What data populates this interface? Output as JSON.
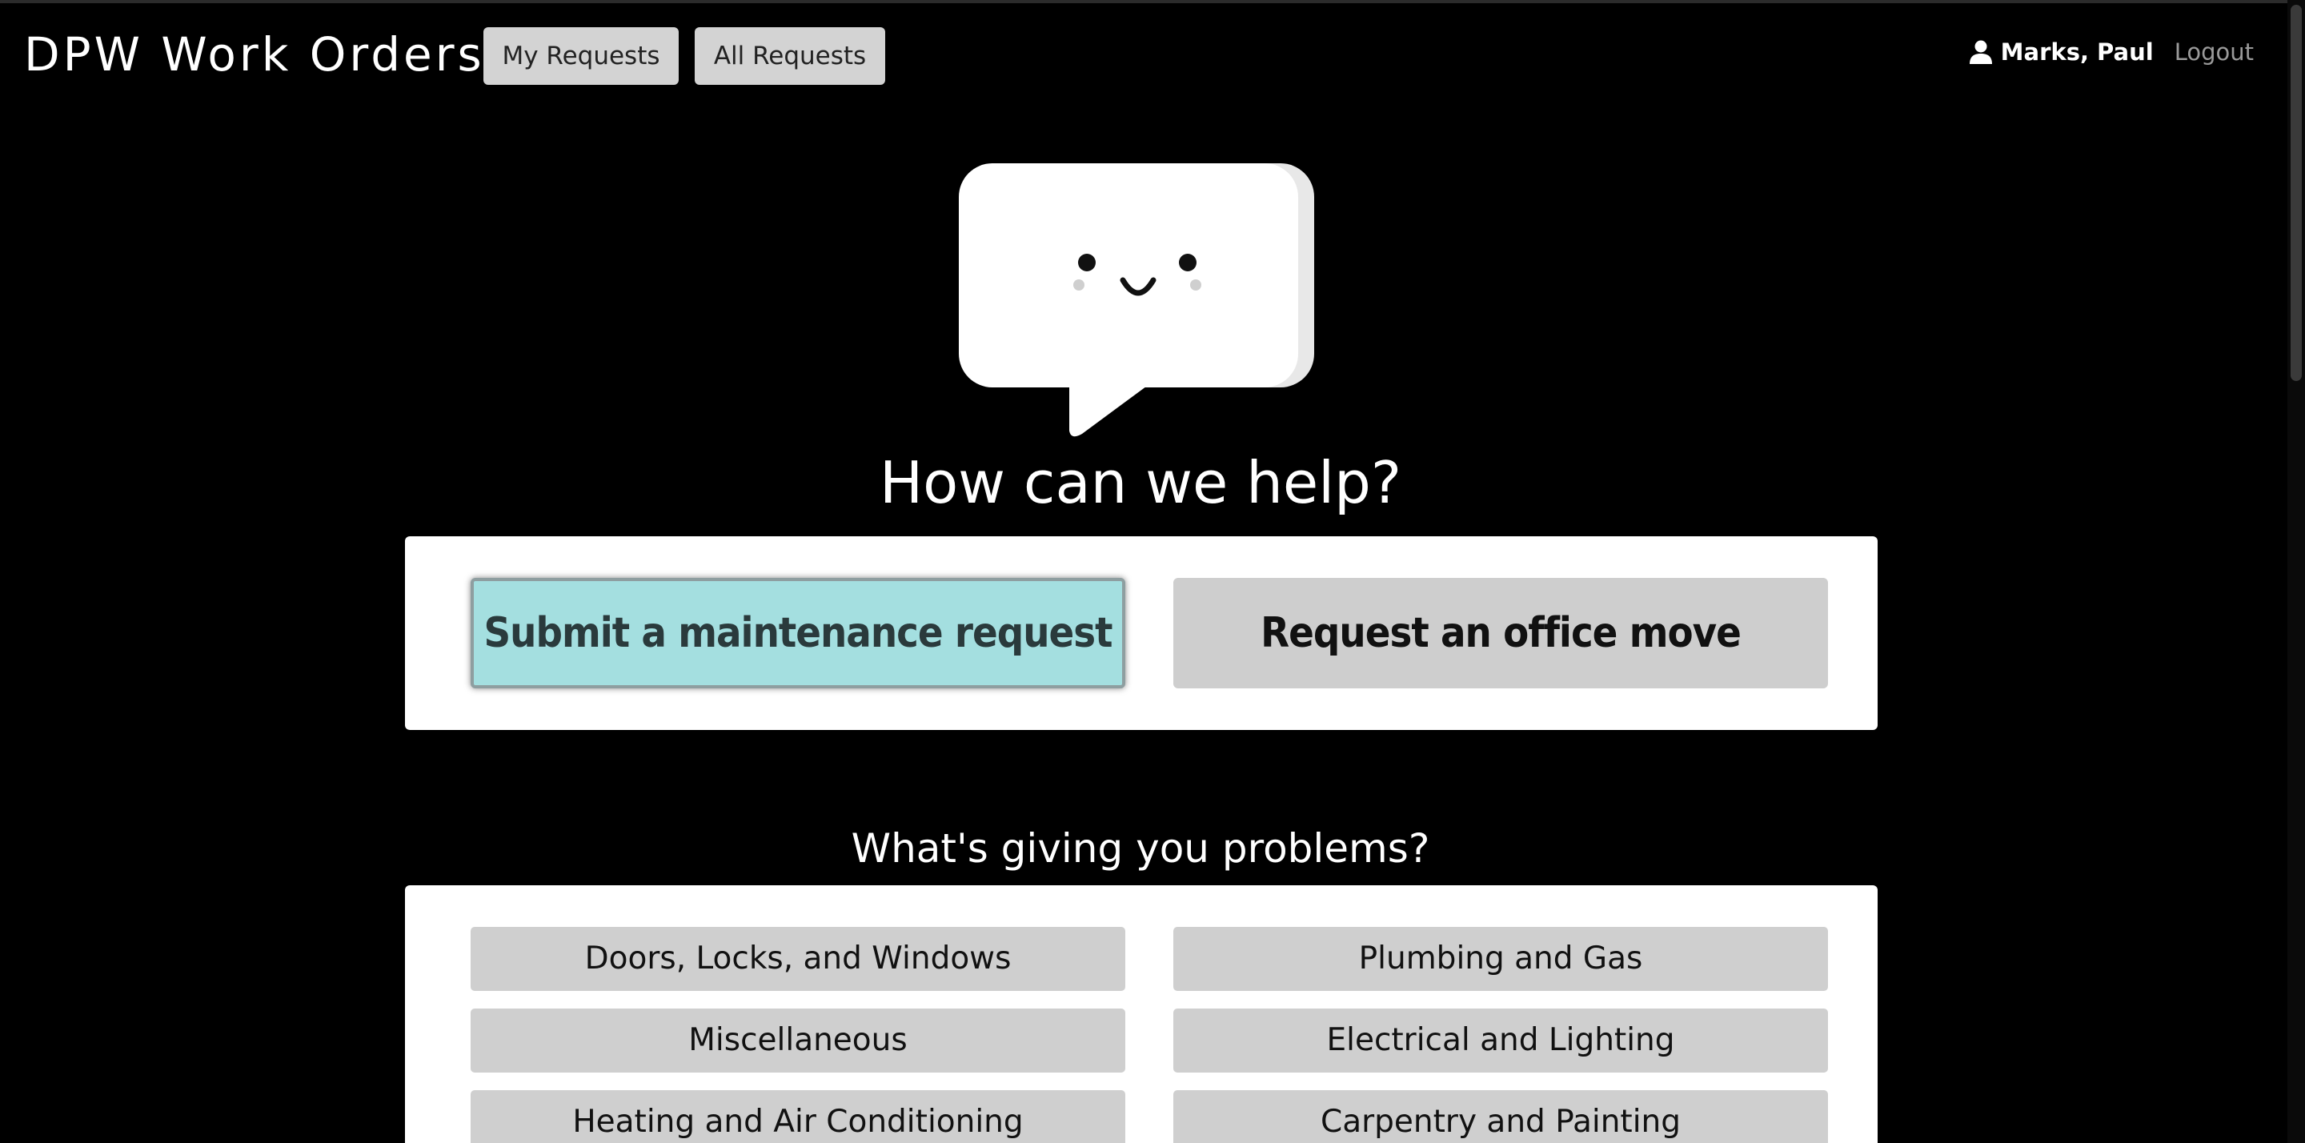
{
  "header": {
    "app_title": "DPW Work Orders",
    "nav": {
      "my_requests": "My Requests",
      "all_requests": "All Requests"
    },
    "user": {
      "icon": "user-icon",
      "name": "Marks, Paul",
      "logout": "Logout"
    }
  },
  "hero": {
    "icon": "smiling-speech-bubble-icon",
    "heading": "How can we help?"
  },
  "actions": {
    "maintenance_label": "Submit a maintenance request",
    "office_move_label": "Request an office move",
    "selected": "maintenance"
  },
  "problems": {
    "heading": "What's giving you problems?",
    "categories": [
      "Doors, Locks, and Windows",
      "Plumbing and Gas",
      "Miscellaneous",
      "Electrical and Lighting",
      "Heating and Air Conditioning",
      "Carpentry and Painting"
    ]
  },
  "colors": {
    "background": "#000000",
    "selected_action": "#a4dfe0",
    "button_gray": "#cecece",
    "panel": "#ffffff"
  }
}
